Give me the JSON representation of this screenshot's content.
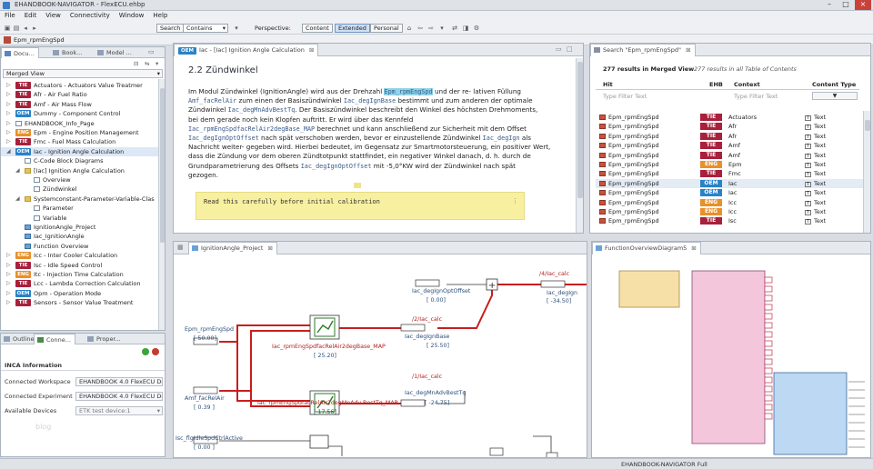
{
  "window": {
    "title": "EHANDBOOK-NAVIGATOR - FlexECU.ehbp"
  },
  "menu": [
    "File",
    "Edit",
    "View",
    "Connectivity",
    "Window",
    "Help"
  ],
  "toolbar": {
    "search_button": "Search",
    "search_mode": "Contains",
    "perspective_label": "Perspective:",
    "perspectives": [
      "Content",
      "Extended",
      "Personal"
    ],
    "active_perspective": "Extended"
  },
  "breadcrumb": {
    "label": "Epm_rpmEngSpd"
  },
  "left_panel": {
    "tabs": [
      "Docu...",
      "Book...",
      "Model ..."
    ],
    "view_selector": "Merged View",
    "tree": [
      {
        "indent": 0,
        "toggle": "▷",
        "badge": "TIE",
        "label": "Actuators - Actuators Value Treatmer"
      },
      {
        "indent": 0,
        "toggle": "▷",
        "badge": "TIE",
        "label": "Afr - Air Fuel Ratio"
      },
      {
        "indent": 0,
        "toggle": "▷",
        "badge": "TIE",
        "label": "Amf - Air Mass Flow"
      },
      {
        "indent": 0,
        "toggle": "▷",
        "badge": "OEM",
        "label": "Dummy - Component Control"
      },
      {
        "indent": 0,
        "toggle": "▷",
        "icon": "doc",
        "label": "EHANDBOOK_Info_Page"
      },
      {
        "indent": 0,
        "toggle": "▷",
        "badge": "ENG",
        "label": "Epm - Engine Position Management"
      },
      {
        "indent": 0,
        "toggle": "▷",
        "badge": "TIE",
        "label": "Fmc - Fuel Mass Calculation"
      },
      {
        "indent": 0,
        "toggle": "◢",
        "badge": "OEM",
        "label": "Iac - Ignition Angle Calculation"
      },
      {
        "indent": 1,
        "toggle": "",
        "icon": "doc",
        "label": "C-Code Block Diagrams"
      },
      {
        "indent": 1,
        "toggle": "◢",
        "icon": "folder",
        "label": "[Iac] Ignition Angle Calculation"
      },
      {
        "indent": 2,
        "toggle": "",
        "icon": "doc",
        "label": "Overview"
      },
      {
        "indent": 2,
        "toggle": "",
        "icon": "doc",
        "label": "Zündwinkel"
      },
      {
        "indent": 1,
        "toggle": "◢",
        "icon": "folder",
        "label": "Systemconstant-Parameter-Variable-Clas"
      },
      {
        "indent": 2,
        "toggle": "",
        "icon": "doc",
        "label": "Parameter"
      },
      {
        "indent": 2,
        "toggle": "",
        "icon": "doc",
        "label": "Variable"
      },
      {
        "indent": 1,
        "toggle": "",
        "icon": "diag",
        "label": "IgnitionAngle_Project"
      },
      {
        "indent": 1,
        "toggle": "",
        "icon": "diag",
        "label": "Iac_IgnitionAngle"
      },
      {
        "indent": 1,
        "toggle": "",
        "icon": "diag",
        "label": "Function Overview"
      },
      {
        "indent": 0,
        "toggle": "▷",
        "badge": "ENG",
        "label": "Icc - Inter Cooler Calculation"
      },
      {
        "indent": 0,
        "toggle": "▷",
        "badge": "TIE",
        "label": "Isc - Idle Speed Control"
      },
      {
        "indent": 0,
        "toggle": "▷",
        "badge": "ENG",
        "label": "Itc - Injection Time Calculation"
      },
      {
        "indent": 0,
        "toggle": "▷",
        "badge": "TIE",
        "label": "Lcc - Lambda Correction Calculation"
      },
      {
        "indent": 0,
        "toggle": "▷",
        "badge": "OEM",
        "label": "Opm - Operation Mode"
      },
      {
        "indent": 0,
        "toggle": "▷",
        "badge": "TIE",
        "label": "Sensors - Sensor Value Treatment"
      }
    ]
  },
  "bottom_left": {
    "tabs": [
      "Outline",
      "Conne...",
      "Proper..."
    ],
    "section_title": "INCA Information",
    "fields": [
      {
        "label": "Connected Workspace",
        "value": "EHANDBOOK 4.0 FlexECU Der"
      },
      {
        "label": "Connected Experiment",
        "value": "EHANDBOOK 4.0 FlexECU Der"
      },
      {
        "label": "Available Devices",
        "value": "ETK test device:1"
      }
    ],
    "watermark": "blog"
  },
  "document": {
    "tab_badge": "OEM",
    "tab_label": "Iac - [Iac] Ignition Angle Calculation",
    "heading": "2.2 Zündwinkel",
    "lines": [
      [
        {
          "t": "Im Modul Zündwinkel (IgnitionAngle) wird aus der Drehzahl "
        },
        {
          "t": "Epm_rpmEngSpd",
          "m": 1,
          "h": 1
        },
        {
          "t": " und der re- lativen Füllung"
        }
      ],
      [
        {
          "t": "Amf_facRelAir",
          "m": 1
        },
        {
          "t": " zum einen der Basiszündwinkel "
        },
        {
          "t": "Iac_degIgnBase",
          "m": 1
        },
        {
          "t": " bestimmt und zum anderen der optimale"
        }
      ],
      [
        {
          "t": "Zündwinkel "
        },
        {
          "t": "Iac_degMnAdvBestTq",
          "m": 1
        },
        {
          "t": ". Der Basiszündwinkel beschreibt den Winkel des höchsten Drehmoments,"
        }
      ],
      [
        {
          "t": "bei dem gerade noch kein Klopfen auftritt. Er wird über das Kennfeld"
        }
      ],
      [
        {
          "t": "Iac_rpmEngSpdfacRelAir2degBase_MAP",
          "m": 1
        },
        {
          "t": " berechnet und kann anschließend zur Sicherheit mit dem Offset"
        }
      ],
      [
        {
          "t": "Iac_degIgnOptOffset",
          "m": 1
        },
        {
          "t": " nach spät verschoben werden, bevor er einzustellende Zündwinkel "
        },
        {
          "t": "Iac_degIgn",
          "m": 1
        },
        {
          "t": " als"
        }
      ],
      [
        {
          "t": "Nachricht weiter- gegeben wird. Hierbei bedeutet, im Gegensatz zur Smartmotorsteuerung, ein positiver Wert,"
        }
      ],
      [
        {
          "t": "dass die Zündung vor dem oberen Zündtotpunkt stattfindet, ein negativer Winkel danach, d. h. durch de"
        }
      ],
      [
        {
          "t": "Grundparametrierung des Offsets "
        },
        {
          "t": "Iac_degIgnOptOffset",
          "m": 1
        },
        {
          "t": " mit -5,0°KW wird der Zündwinkel nach spät"
        }
      ],
      [
        {
          "t": "gezogen."
        }
      ]
    ],
    "note": "Read this carefully before initial calibration"
  },
  "search": {
    "tab_label": "Search \"Epm_rpmEngSpd\"",
    "summary_bold": "277 results in Merged View",
    "summary_italic": "277 results in all Table of Contents",
    "columns": [
      "Hit",
      "EHB",
      "Context",
      "Content Type"
    ],
    "filter_placeholder": "Type Filter Text",
    "rows": [
      {
        "hit": "Epm_rpmEngSpd",
        "ehb": "TIE",
        "context": "Actuators",
        "type": "Text"
      },
      {
        "hit": "Epm_rpmEngSpd",
        "ehb": "TIE",
        "context": "Afr",
        "type": "Text"
      },
      {
        "hit": "Epm_rpmEngSpd",
        "ehb": "TIE",
        "context": "Afr",
        "type": "Text"
      },
      {
        "hit": "Epm_rpmEngSpd",
        "ehb": "TIE",
        "context": "Amf",
        "type": "Text"
      },
      {
        "hit": "Epm_rpmEngSpd",
        "ehb": "TIE",
        "context": "Amf",
        "type": "Text"
      },
      {
        "hit": "Epm_rpmEngSpd",
        "ehb": "ENG",
        "context": "Epm",
        "type": "Text"
      },
      {
        "hit": "Epm_rpmEngSpd",
        "ehb": "TIE",
        "context": "Fmc",
        "type": "Text"
      },
      {
        "hit": "Epm_rpmEngSpd",
        "ehb": "OEM",
        "context": "Iac",
        "type": "Text"
      },
      {
        "hit": "Epm_rpmEngSpd",
        "ehb": "OEM",
        "context": "Iac",
        "type": "Text"
      },
      {
        "hit": "Epm_rpmEngSpd",
        "ehb": "ENG",
        "context": "Icc",
        "type": "Text"
      },
      {
        "hit": "Epm_rpmEngSpd",
        "ehb": "ENG",
        "context": "Icc",
        "type": "Text"
      },
      {
        "hit": "Epm_rpmEngSpd",
        "ehb": "TIE",
        "context": "Isc",
        "type": "Text"
      }
    ]
  },
  "diagram": {
    "tab_label": "IgnitionAngle_Project",
    "labels": {
      "in1_name": "Epm_rpmEngSpd",
      "in1_val": "[ 50.00]",
      "in2_name": "Amf_facRelAir",
      "in2_val": "[ 0.39 ]",
      "in3_name": "Isc_flgIdleSpdCtrlActive",
      "in3_val": "[ 0.00 ]",
      "map1": "Iac_rpmEngSpdfacRelAir2degBase_MAP",
      "map1_val": "[ 25.20]",
      "map2": "Iac_rpmEngSpdfacRelAir2degMnAdv-BestTq_MAP",
      "map2_val": "[ 17.56]",
      "off": "Iac_degIgnOptOffset",
      "off_val": "[ 0.00]",
      "base": "Iac_degIgnBase",
      "base_val": "[ 25.50]",
      "best": "Iac_degMnAdvBestTq",
      "best_val": "[ -24.75]",
      "ign": "Iac_degIgn",
      "ign_val": "[ -34.50]",
      "calc4": "/4/Iac_calc",
      "calc2": "/2/Iac_calc",
      "calc1": "/1/Iac_calc"
    }
  },
  "overview": {
    "tab_label": "FunctionOverviewDiagram5"
  },
  "status": {
    "text": "EHANDBOOK-NAVIGATOR Full"
  }
}
